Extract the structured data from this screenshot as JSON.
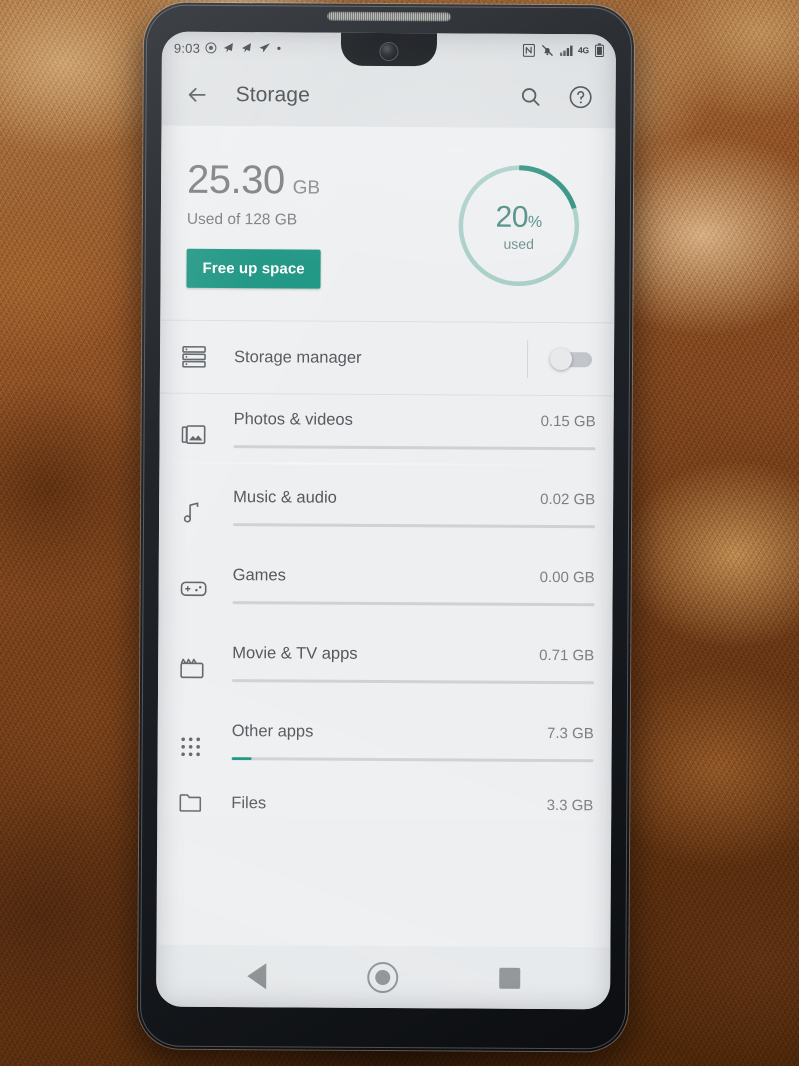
{
  "statusbar": {
    "time": "9:03",
    "left_icons": [
      "dnd-circle-icon",
      "telegram-arrow-icon",
      "telegram-arrow-icon",
      "send-arrow-icon",
      "dot-icon"
    ],
    "right_icons": [
      "nfc-icon",
      "vibrate-off-icon",
      "signal-bars-icon",
      "battery-icon"
    ],
    "network_label": "4G"
  },
  "appbar": {
    "back_icon": "arrow-back-icon",
    "title": "Storage",
    "search_icon": "search-icon",
    "help_icon": "help-circle-icon"
  },
  "summary": {
    "used_value": "25.30",
    "used_unit": "GB",
    "used_of": "Used of 128 GB",
    "free_button": "Free up space",
    "donut_percent": "20",
    "donut_percent_symbol": "%",
    "donut_sub": "used",
    "donut_fill_ratio": 0.2,
    "accent_color": "#1a9481",
    "donut_track_color": "#a9cfc8",
    "donut_text_color": "#4e8d84"
  },
  "storage_manager": {
    "icon": "storage-manager-icon",
    "label": "Storage manager",
    "toggle_state": "off"
  },
  "categories": [
    {
      "icon": "photos-icon",
      "name": "Photos & videos",
      "size": "0.15 GB",
      "bar_fill": 0.0
    },
    {
      "icon": "music-icon",
      "name": "Music & audio",
      "size": "0.02 GB",
      "bar_fill": 0.0
    },
    {
      "icon": "games-icon",
      "name": "Games",
      "size": "0.00 GB",
      "bar_fill": 0.0
    },
    {
      "icon": "movies-icon",
      "name": "Movie & TV apps",
      "size": "0.71 GB",
      "bar_fill": 0.0
    },
    {
      "icon": "apps-grid-icon",
      "name": "Other apps",
      "size": "7.3 GB",
      "bar_fill": 0.055
    },
    {
      "icon": "files-icon",
      "name": "Files",
      "size": "3.3 GB",
      "bar_fill": 0.0
    }
  ],
  "navbar": {
    "back_icon": "nav-back-icon",
    "home_icon": "nav-home-icon",
    "recents_icon": "nav-recents-icon"
  }
}
